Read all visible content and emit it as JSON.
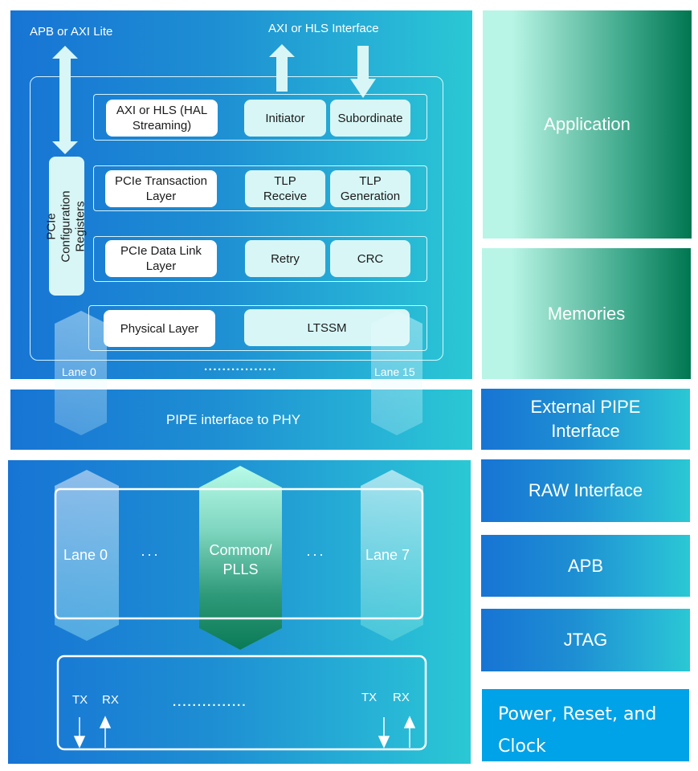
{
  "controller": {
    "top_labels": {
      "apb_axi_lite": "APB or AXI Lite",
      "axi_hls_interface": "AXI or HLS Interface"
    },
    "config_registers": "PCIe Configuration Registers",
    "layers": [
      {
        "name": "AXI or HLS (HAL Streaming)",
        "blocks": [
          "Initiator",
          "Subordinate"
        ]
      },
      {
        "name": "PCIe Transaction Layer",
        "blocks": [
          "TLP Receive",
          "TLP Generation"
        ]
      },
      {
        "name": "PCIe Data Link Layer",
        "blocks": [
          "Retry",
          "CRC"
        ]
      },
      {
        "name": "Physical Layer",
        "blocks": [
          "LTSSM"
        ]
      }
    ],
    "lanes": {
      "first": "Lane 0",
      "last": "Lane 15",
      "ellipsis": "................"
    }
  },
  "pipe": {
    "label": "PIPE interface to PHY"
  },
  "phy": {
    "lane_first": "Lane 0",
    "lane_last": "Lane 7",
    "common": "Common/ PLLS",
    "ellipsis": "···",
    "io": {
      "tx": "TX",
      "rx": "RX",
      "dots": "..............."
    }
  },
  "legend": [
    {
      "label": "Application",
      "style": "green"
    },
    {
      "label": "Memories",
      "style": "green"
    },
    {
      "label": "External PIPE Interface",
      "style": "blue"
    },
    {
      "label": "RAW Interface",
      "style": "blue"
    },
    {
      "label": "APB",
      "style": "blue"
    },
    {
      "label": "JTAG",
      "style": "blue"
    },
    {
      "label": "Power, Reset, and Clock",
      "style": "solid"
    }
  ],
  "colors": {
    "blue_start": "#1774d4",
    "blue_end": "#2ac8d4",
    "green_light": "#b8f5e6",
    "green_dark": "#007650",
    "solid_blue": "#00a2e8",
    "block_light": "#d8f6f6"
  }
}
